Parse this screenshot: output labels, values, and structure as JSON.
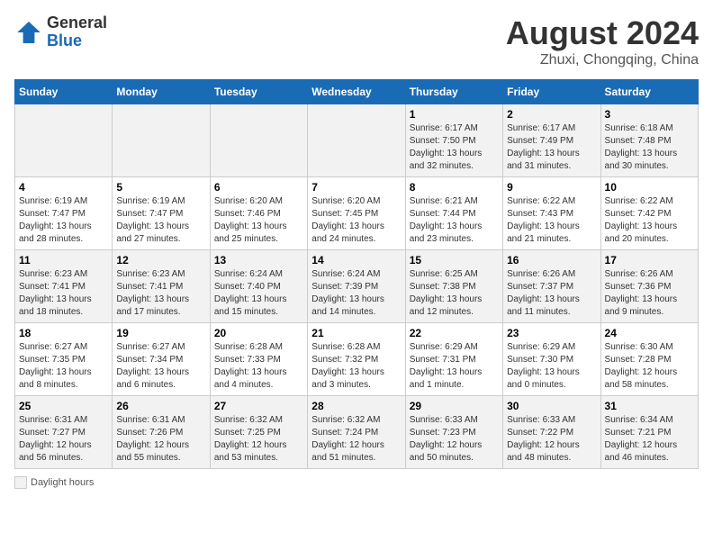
{
  "header": {
    "logo_general": "General",
    "logo_blue": "Blue",
    "title": "August 2024",
    "subtitle": "Zhuxi, Chongqing, China"
  },
  "days_of_week": [
    "Sunday",
    "Monday",
    "Tuesday",
    "Wednesday",
    "Thursday",
    "Friday",
    "Saturday"
  ],
  "weeks": [
    [
      {
        "day": "",
        "info": ""
      },
      {
        "day": "",
        "info": ""
      },
      {
        "day": "",
        "info": ""
      },
      {
        "day": "",
        "info": ""
      },
      {
        "day": "1",
        "info": "Sunrise: 6:17 AM\nSunset: 7:50 PM\nDaylight: 13 hours and 32 minutes."
      },
      {
        "day": "2",
        "info": "Sunrise: 6:17 AM\nSunset: 7:49 PM\nDaylight: 13 hours and 31 minutes."
      },
      {
        "day": "3",
        "info": "Sunrise: 6:18 AM\nSunset: 7:48 PM\nDaylight: 13 hours and 30 minutes."
      }
    ],
    [
      {
        "day": "4",
        "info": "Sunrise: 6:19 AM\nSunset: 7:47 PM\nDaylight: 13 hours and 28 minutes."
      },
      {
        "day": "5",
        "info": "Sunrise: 6:19 AM\nSunset: 7:47 PM\nDaylight: 13 hours and 27 minutes."
      },
      {
        "day": "6",
        "info": "Sunrise: 6:20 AM\nSunset: 7:46 PM\nDaylight: 13 hours and 25 minutes."
      },
      {
        "day": "7",
        "info": "Sunrise: 6:20 AM\nSunset: 7:45 PM\nDaylight: 13 hours and 24 minutes."
      },
      {
        "day": "8",
        "info": "Sunrise: 6:21 AM\nSunset: 7:44 PM\nDaylight: 13 hours and 23 minutes."
      },
      {
        "day": "9",
        "info": "Sunrise: 6:22 AM\nSunset: 7:43 PM\nDaylight: 13 hours and 21 minutes."
      },
      {
        "day": "10",
        "info": "Sunrise: 6:22 AM\nSunset: 7:42 PM\nDaylight: 13 hours and 20 minutes."
      }
    ],
    [
      {
        "day": "11",
        "info": "Sunrise: 6:23 AM\nSunset: 7:41 PM\nDaylight: 13 hours and 18 minutes."
      },
      {
        "day": "12",
        "info": "Sunrise: 6:23 AM\nSunset: 7:41 PM\nDaylight: 13 hours and 17 minutes."
      },
      {
        "day": "13",
        "info": "Sunrise: 6:24 AM\nSunset: 7:40 PM\nDaylight: 13 hours and 15 minutes."
      },
      {
        "day": "14",
        "info": "Sunrise: 6:24 AM\nSunset: 7:39 PM\nDaylight: 13 hours and 14 minutes."
      },
      {
        "day": "15",
        "info": "Sunrise: 6:25 AM\nSunset: 7:38 PM\nDaylight: 13 hours and 12 minutes."
      },
      {
        "day": "16",
        "info": "Sunrise: 6:26 AM\nSunset: 7:37 PM\nDaylight: 13 hours and 11 minutes."
      },
      {
        "day": "17",
        "info": "Sunrise: 6:26 AM\nSunset: 7:36 PM\nDaylight: 13 hours and 9 minutes."
      }
    ],
    [
      {
        "day": "18",
        "info": "Sunrise: 6:27 AM\nSunset: 7:35 PM\nDaylight: 13 hours and 8 minutes."
      },
      {
        "day": "19",
        "info": "Sunrise: 6:27 AM\nSunset: 7:34 PM\nDaylight: 13 hours and 6 minutes."
      },
      {
        "day": "20",
        "info": "Sunrise: 6:28 AM\nSunset: 7:33 PM\nDaylight: 13 hours and 4 minutes."
      },
      {
        "day": "21",
        "info": "Sunrise: 6:28 AM\nSunset: 7:32 PM\nDaylight: 13 hours and 3 minutes."
      },
      {
        "day": "22",
        "info": "Sunrise: 6:29 AM\nSunset: 7:31 PM\nDaylight: 13 hours and 1 minute."
      },
      {
        "day": "23",
        "info": "Sunrise: 6:29 AM\nSunset: 7:30 PM\nDaylight: 13 hours and 0 minutes."
      },
      {
        "day": "24",
        "info": "Sunrise: 6:30 AM\nSunset: 7:28 PM\nDaylight: 12 hours and 58 minutes."
      }
    ],
    [
      {
        "day": "25",
        "info": "Sunrise: 6:31 AM\nSunset: 7:27 PM\nDaylight: 12 hours and 56 minutes."
      },
      {
        "day": "26",
        "info": "Sunrise: 6:31 AM\nSunset: 7:26 PM\nDaylight: 12 hours and 55 minutes."
      },
      {
        "day": "27",
        "info": "Sunrise: 6:32 AM\nSunset: 7:25 PM\nDaylight: 12 hours and 53 minutes."
      },
      {
        "day": "28",
        "info": "Sunrise: 6:32 AM\nSunset: 7:24 PM\nDaylight: 12 hours and 51 minutes."
      },
      {
        "day": "29",
        "info": "Sunrise: 6:33 AM\nSunset: 7:23 PM\nDaylight: 12 hours and 50 minutes."
      },
      {
        "day": "30",
        "info": "Sunrise: 6:33 AM\nSunset: 7:22 PM\nDaylight: 12 hours and 48 minutes."
      },
      {
        "day": "31",
        "info": "Sunrise: 6:34 AM\nSunset: 7:21 PM\nDaylight: 12 hours and 46 minutes."
      }
    ]
  ],
  "footer": {
    "daylight_label": "Daylight hours"
  }
}
